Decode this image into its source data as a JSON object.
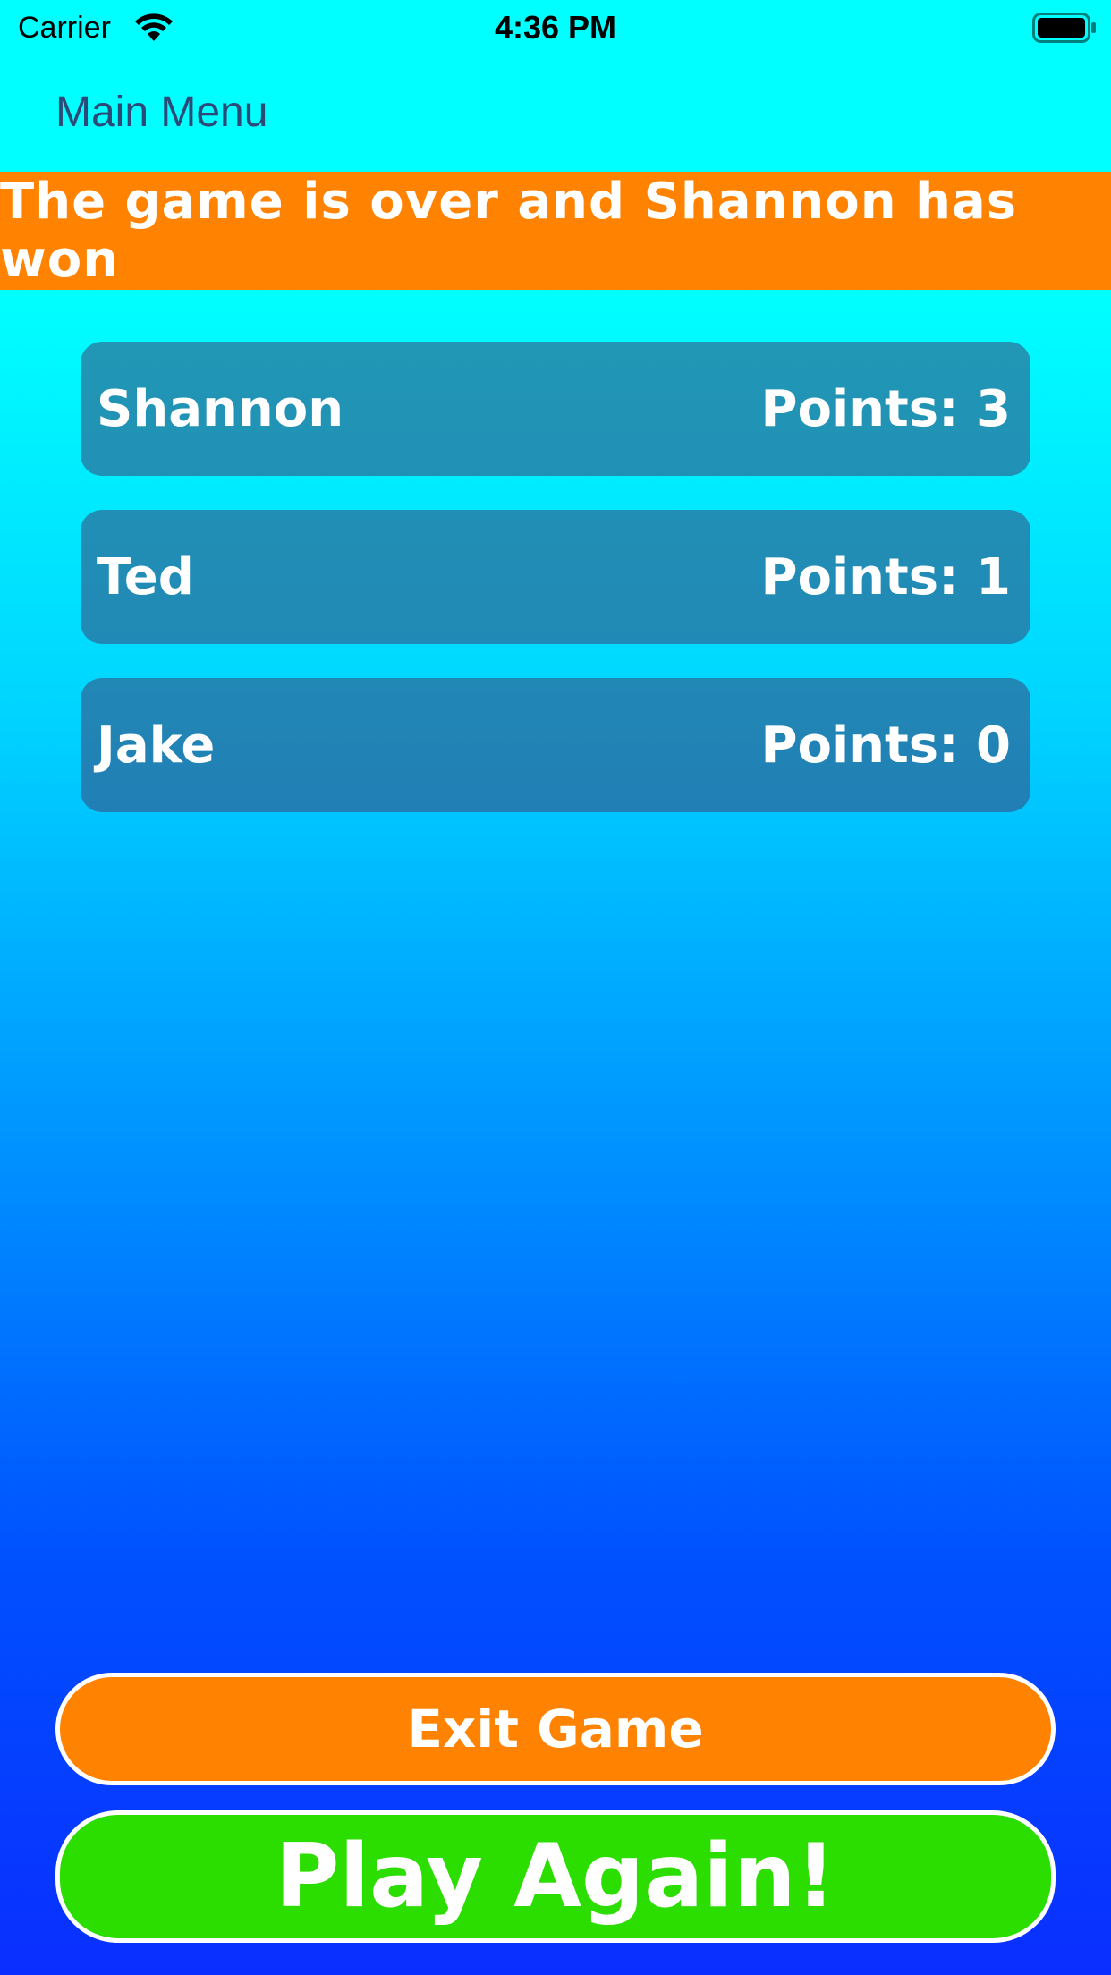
{
  "status_bar": {
    "carrier": "Carrier",
    "time": "4:36 PM",
    "wifi_icon": "wifi-icon",
    "battery_icon": "battery-icon"
  },
  "nav": {
    "back_label": "Main Menu"
  },
  "banner": {
    "text": "The game is over and Shannon has won",
    "color": "#ff8300"
  },
  "players": [
    {
      "name": "Shannon",
      "points": "Points: 3"
    },
    {
      "name": "Ted",
      "points": "Points: 1"
    },
    {
      "name": "Jake",
      "points": "Points: 0"
    }
  ],
  "buttons": {
    "exit_label": "Exit Game",
    "exit_color": "#ff8300",
    "play_again_label": "Play Again!",
    "play_again_color": "#2cdd00"
  }
}
